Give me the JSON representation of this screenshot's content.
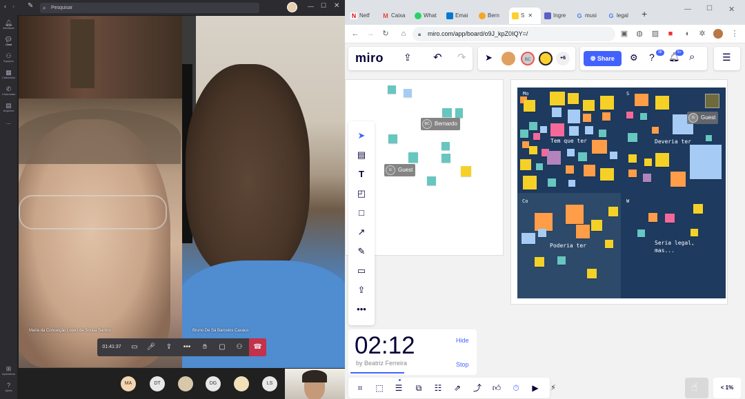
{
  "teams": {
    "search_placeholder": "Pesquisar",
    "rail": [
      {
        "icon": "bell-icon",
        "label": "Atividade"
      },
      {
        "icon": "chat-icon",
        "label": "Chat"
      },
      {
        "icon": "teams-icon",
        "label": "Equipes"
      },
      {
        "icon": "calendar-icon",
        "label": "Calendário"
      },
      {
        "icon": "phone-icon",
        "label": "Chamadas"
      },
      {
        "icon": "files-icon",
        "label": "Arquivos"
      },
      {
        "icon": "more-icon",
        "label": "..."
      },
      {
        "icon": "apps-icon",
        "label": "Aplicativos"
      },
      {
        "icon": "help-icon",
        "label": "Ajuda"
      }
    ],
    "participant_left": "Maria da Conceição Lopes de Sousa Santos",
    "participant_right": "Bruno De Sá Barcelos Cavaco",
    "call_timer": "01:41:37",
    "bottom_participants": [
      {
        "initials": "MA",
        "color": "#f5d5b0"
      },
      {
        "initials": "DT",
        "color": "#e8e8e8"
      },
      {
        "initials": "",
        "color": "#d9c7a9"
      },
      {
        "initials": "DG",
        "color": "#e8e8e8"
      },
      {
        "initials": "",
        "color": "#f2e0b8"
      },
      {
        "initials": "LS",
        "color": "#e8e8e8"
      }
    ]
  },
  "browser": {
    "tabs": [
      {
        "label": "Netf",
        "color": "#e50914",
        "glyph": "N"
      },
      {
        "label": "Caixa",
        "color": "#ea4335",
        "glyph": "M"
      },
      {
        "label": "What",
        "color": "#25d366",
        "glyph": "◉"
      },
      {
        "label": "Emai",
        "color": "#0078d4",
        "glyph": "✉"
      },
      {
        "label": "Bern",
        "color": "#f5a623",
        "glyph": "☺"
      },
      {
        "label": "S",
        "color": "#ffd02f",
        "glyph": "M"
      },
      {
        "label": "Ingre",
        "color": "#5b5fc7",
        "glyph": "T"
      },
      {
        "label": "musi",
        "color": "#4285f4",
        "glyph": "G"
      },
      {
        "label": "legal",
        "color": "#4285f4",
        "glyph": "G"
      }
    ],
    "url": "miro.com/app/board/o9J_kpZ0IQY=/"
  },
  "miro": {
    "logo": "miro",
    "share_label": "Share",
    "collab_count": "+6",
    "badge_help": "38",
    "badge_notif": "9+",
    "avatar_bc": "BC",
    "cursor_bernardo": "Bernardo",
    "cursor_guest1": "Guest",
    "cursor_guest2": "Guest",
    "cursor_bc_initials": "BC",
    "cursor_g_initials": "G",
    "quadrants": [
      {
        "tag": "Mo",
        "title": "Tem que ter"
      },
      {
        "tag": "S",
        "title": "Deveria ter"
      },
      {
        "tag": "Co",
        "title": "Poderia ter"
      },
      {
        "tag": "W",
        "title": "Seria legal,\nmas..."
      }
    ],
    "timer_value": "02:12",
    "timer_author": "by Beatriz Ferreira",
    "timer_hide": "Hide",
    "timer_stop": "Stop",
    "zoom": "< 1%"
  }
}
